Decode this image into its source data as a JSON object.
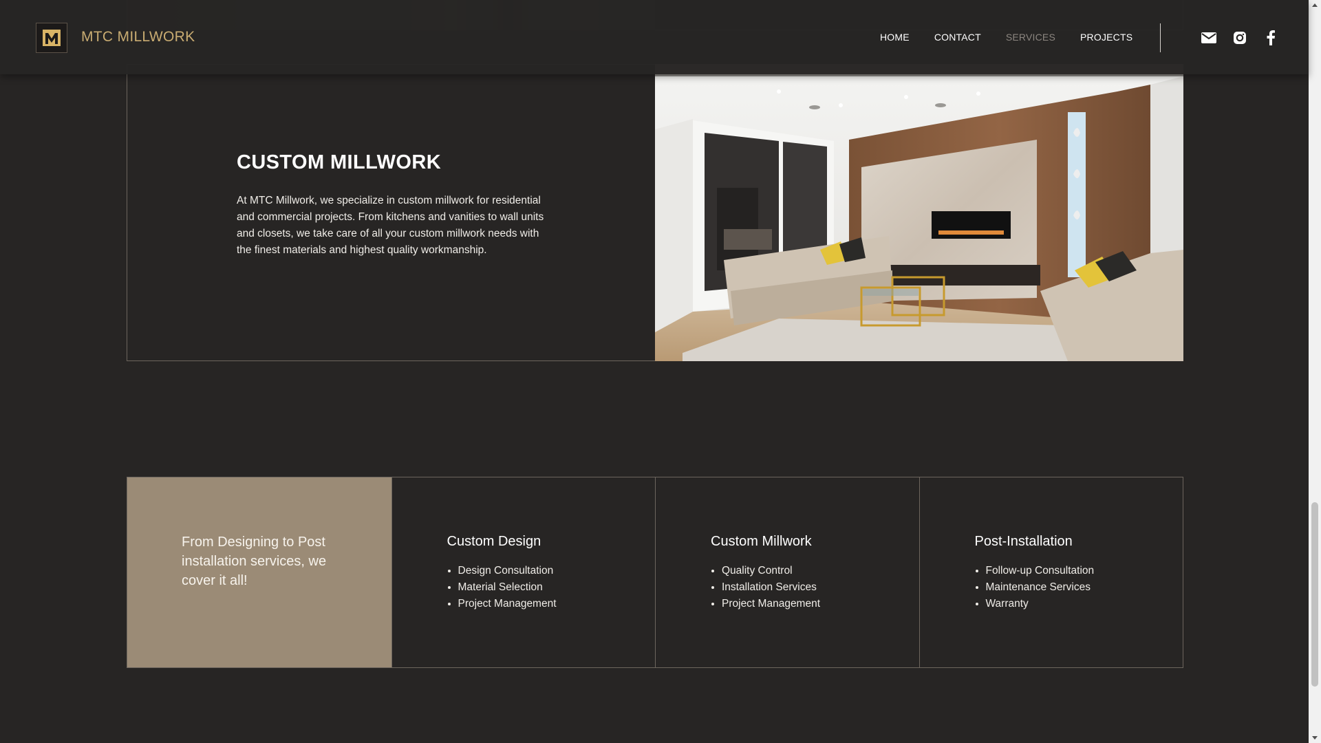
{
  "header": {
    "brand": "MTC MILLWORK",
    "logo_letter": "M",
    "nav": [
      "HOME",
      "CONTACT",
      "SERVICES",
      "PROJECTS"
    ],
    "active_nav": "SERVICES",
    "social_icons": [
      "mail-icon",
      "instagram-icon",
      "facebook-icon"
    ]
  },
  "millwork": {
    "title": "CUSTOM MILLWORK",
    "description": "At MTC Millwork, we specialize in custom millwork for residential and commercial projects. From kitchens and vanities to wall units and closets, we take care of all your custom millwork needs with the finest materials and highest quality workmanship."
  },
  "services": {
    "intro": "From Designing to Post installation services, we cover it all!",
    "columns": [
      {
        "title": "Custom Design",
        "items": [
          "Design Consultation",
          "Material Selection",
          "Project Management"
        ]
      },
      {
        "title": "Custom Millwork",
        "items": [
          "Quality Control",
          "Installation Services",
          "Project Management"
        ]
      },
      {
        "title": "Post-Installation",
        "items": [
          "Follow-up Consultation",
          "Maintenance Services",
          "Warranty"
        ]
      }
    ]
  },
  "colors": {
    "background": "#272524",
    "accent_gold": "#c9ac72",
    "intro_panel": "#9b8b76",
    "border": "#6d665e"
  }
}
